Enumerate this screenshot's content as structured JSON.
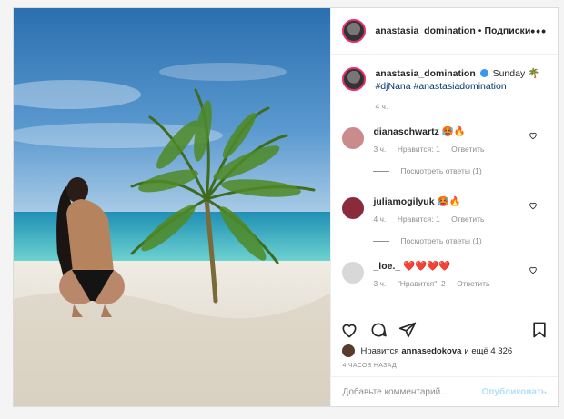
{
  "post": {
    "username": "anastasia_domination",
    "dot": "•",
    "follow_label": "Подписки",
    "more_label": "•••"
  },
  "caption": {
    "username": "anastasia_domination",
    "text": "Sunday 🌴",
    "hashtags": "#djNana #anastasiadomination",
    "time": "4 ч."
  },
  "comments": [
    {
      "username": "dianaschwartz",
      "text": "🥵🔥",
      "time": "3 ч.",
      "likes": "Нравится: 1",
      "reply": "Ответить",
      "view_replies": "Посмотреть ответы (1)",
      "avatar_color": "#c98b8b"
    },
    {
      "username": "juliamogilyuk",
      "text": "🥵🔥",
      "time": "4 ч.",
      "likes": "Нравится: 1",
      "reply": "Ответить",
      "view_replies": "Посмотреть ответы (1)",
      "avatar_color": "#8a2a3a"
    },
    {
      "username": "_loe._",
      "text": "❤️❤️❤️❤️",
      "time": "3 ч.",
      "likes": "\"Нравится\": 2",
      "reply": "Ответить",
      "view_replies": "",
      "avatar_color": "#d8d8d8"
    }
  ],
  "likes_line": {
    "prefix": "Нравится",
    "user": "annasedokova",
    "suffix": "и ещё 4 326"
  },
  "time_ago": "4 ЧАСОВ НАЗАД",
  "add_comment": {
    "placeholder": "Добавьте комментарий...",
    "publish": "Опубликовать"
  }
}
